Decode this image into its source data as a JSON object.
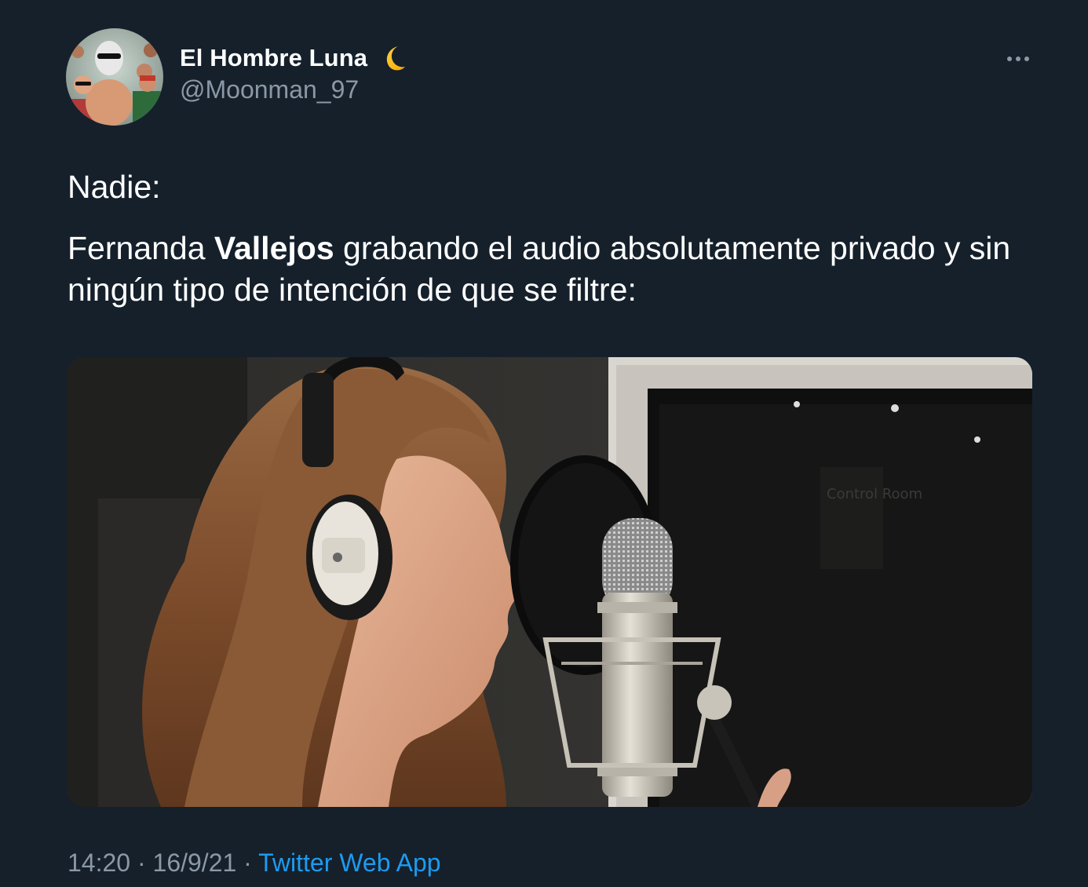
{
  "author": {
    "display_name": "El Hombre Luna",
    "name_emoji_icon": "crescent-moon-icon",
    "handle": "@Moonman_97",
    "avatar_icon": "profile-avatar"
  },
  "tweet": {
    "line1": "Nadie:",
    "line2_before": "Fernanda ",
    "line2_bold": "Vallejos",
    "line2_after": " grabando el audio absolutamente privado y sin ningún tipo de intención de que se filtre:",
    "media": {
      "kind": "photo",
      "background_sign": "Control Room"
    }
  },
  "meta": {
    "time": "14:20",
    "separator1": " · ",
    "date": "16/9/21",
    "separator2": " · ",
    "source": "Twitter Web App"
  },
  "more_menu_icon": "more-dots-icon",
  "colors": {
    "background": "#15202b",
    "text_primary": "#ffffff",
    "text_secondary": "#8b98a5",
    "link": "#1d9bf0"
  }
}
